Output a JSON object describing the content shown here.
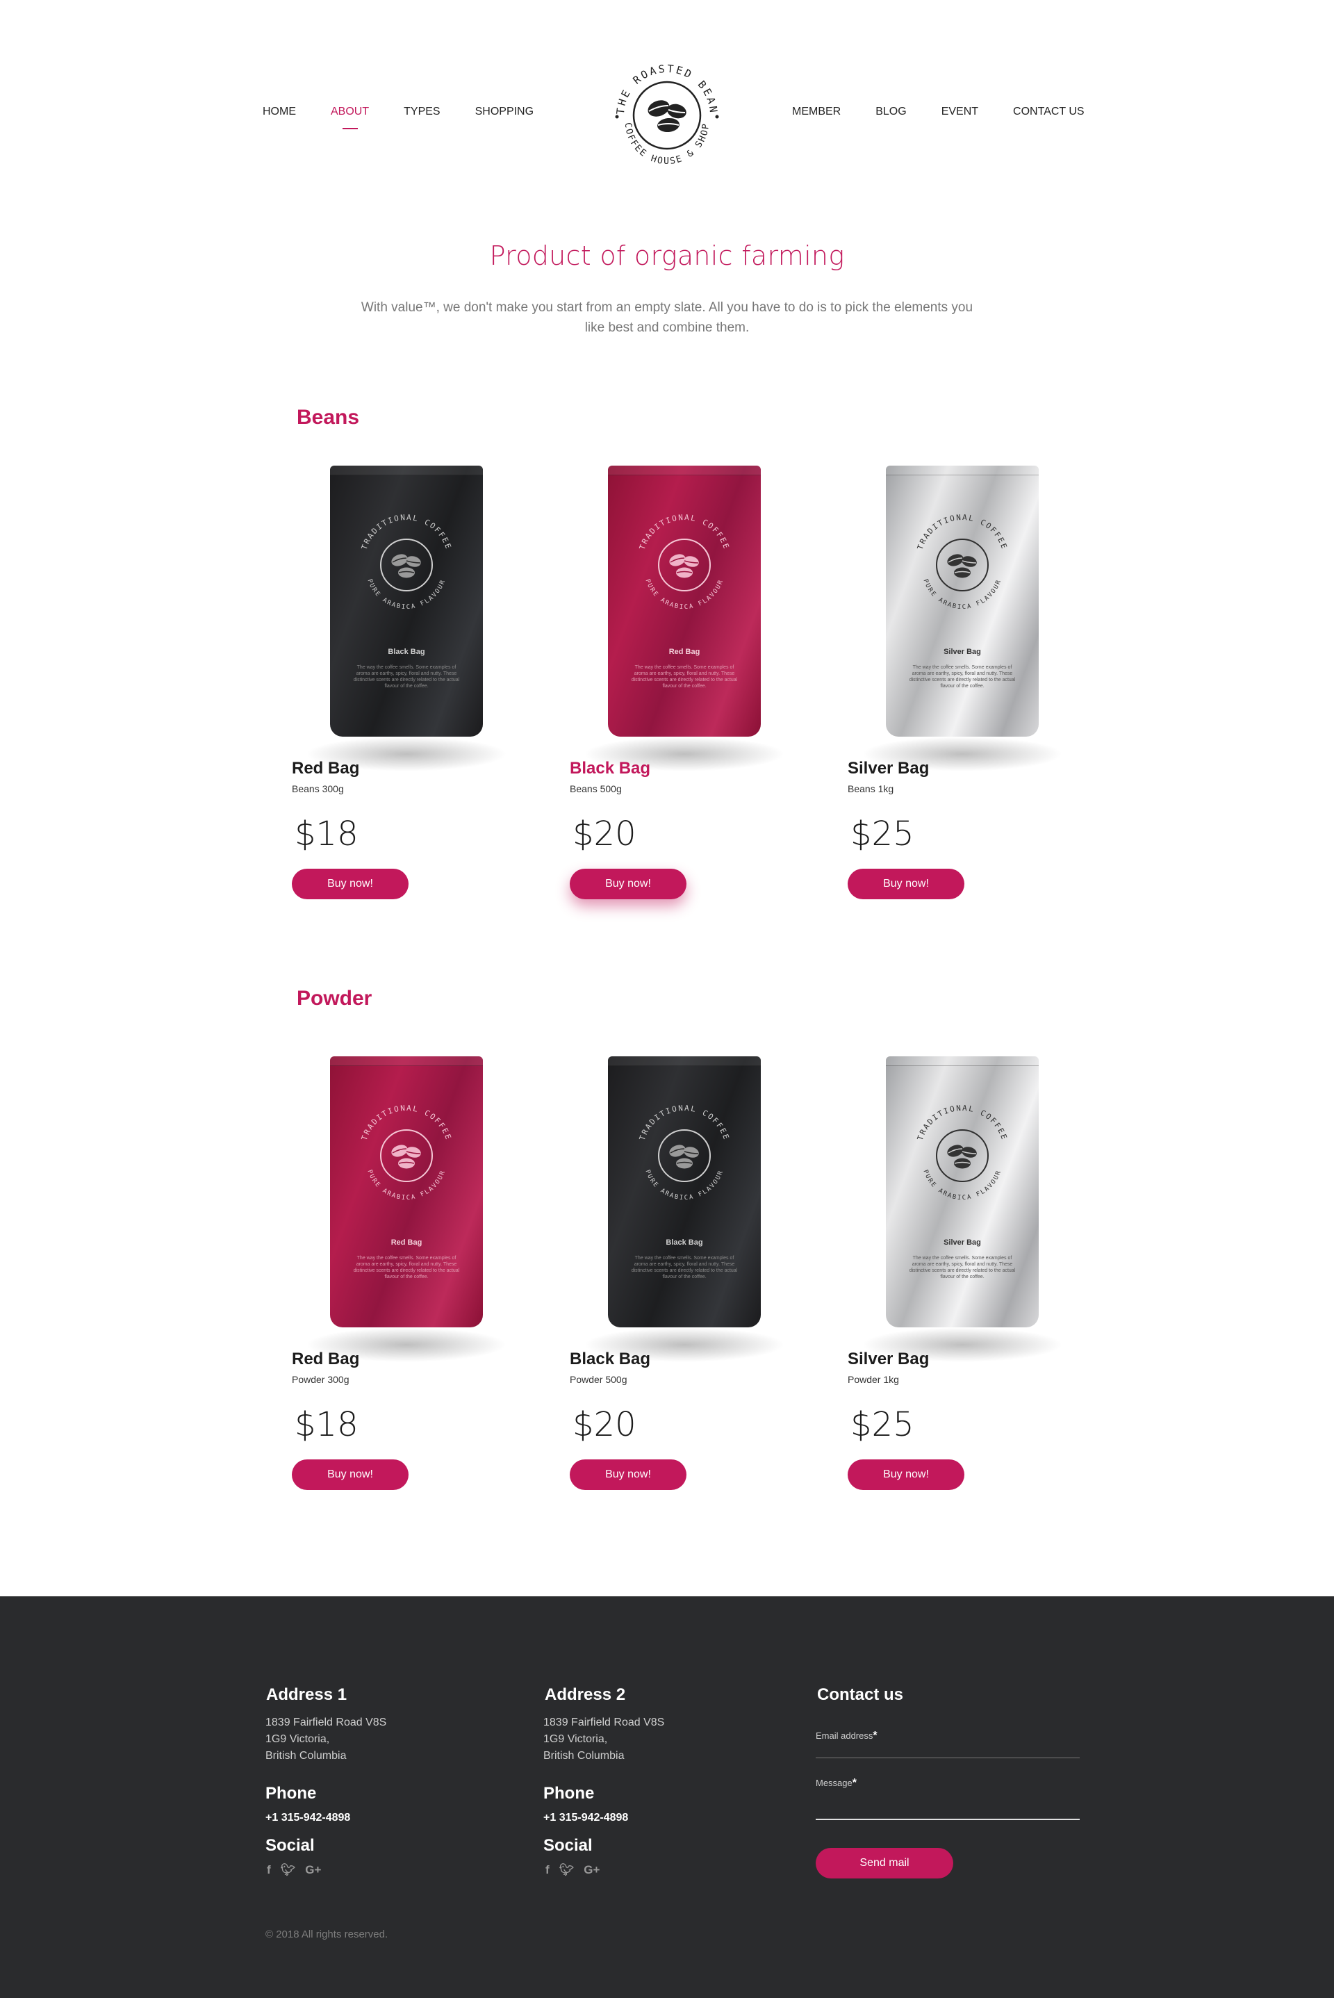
{
  "nav": {
    "left": [
      "HOME",
      "ABOUT",
      "TYPES",
      "SHOPPING"
    ],
    "right": [
      "MEMBER",
      "BLOG",
      "EVENT",
      "CONTACT US"
    ],
    "active": "ABOUT"
  },
  "logo": {
    "top_text": "THE ROASTED BEAN",
    "bottom_text": "COFFEE HOUSE & SHOP"
  },
  "hero": {
    "title": "Product of organic farming",
    "subtitle": "With value™, we don't make you start from an empty slate. All you have to do is to pick the elements you like best and combine them."
  },
  "bag_print": {
    "arc_top": "TRADITIONAL COFFEE",
    "arc_bottom": "PURE ARABICA FLAVOUR",
    "copy": "The way the coffee smells. Some examples of aroma are earthy, spicy, floral and nutty. These distinctive scents are directly related to the actual flavour of the coffee."
  },
  "sections": [
    {
      "title": "Beans",
      "products": [
        {
          "bag": "black",
          "bag_label": "Black Bag",
          "name": "Red Bag",
          "weight": "Beans 300g",
          "price": "$18",
          "button": "Buy now!",
          "highlight": false
        },
        {
          "bag": "red",
          "bag_label": "Red Bag",
          "name": "Black Bag",
          "weight": "Beans 500g",
          "price": "$20",
          "button": "Buy now!",
          "highlight": true
        },
        {
          "bag": "silver",
          "bag_label": "Silver Bag",
          "name": "Silver Bag",
          "weight": "Beans 1kg",
          "price": "$25",
          "button": "Buy now!",
          "highlight": false
        }
      ]
    },
    {
      "title": "Powder",
      "products": [
        {
          "bag": "red",
          "bag_label": "Red Bag",
          "name": "Red Bag",
          "weight": "Powder 300g",
          "price": "$18",
          "button": "Buy now!",
          "highlight": false
        },
        {
          "bag": "black",
          "bag_label": "Black Bag",
          "name": "Black Bag",
          "weight": "Powder 500g",
          "price": "$20",
          "button": "Buy now!",
          "highlight": false
        },
        {
          "bag": "silver",
          "bag_label": "Silver Bag",
          "name": "Silver Bag",
          "weight": "Powder 1kg",
          "price": "$25",
          "button": "Buy now!",
          "highlight": false
        }
      ]
    }
  ],
  "footer": {
    "address1": {
      "title": "Address 1",
      "lines": [
        "1839 Fairfield Road V8S",
        "1G9 Victoria,",
        "British Columbia"
      ]
    },
    "address2": {
      "title": "Address 2",
      "lines": [
        "1839 Fairfield Road V8S",
        "1G9 Victoria,",
        "British Columbia"
      ]
    },
    "phone_title": "Phone",
    "phone": "+1 315-942-4898",
    "social_title": "Social",
    "social_icons": [
      "facebook-icon",
      "twitter-icon",
      "google-plus-icon"
    ],
    "contact": {
      "title": "Contact us",
      "email_label": "Email address",
      "message_label": "Message",
      "required_mark": "*",
      "send": "Send mail"
    },
    "copyright": "© 2018 All rights reserved."
  },
  "colors": {
    "accent": "#c2185b",
    "footer_bg": "#2a2b2d"
  }
}
